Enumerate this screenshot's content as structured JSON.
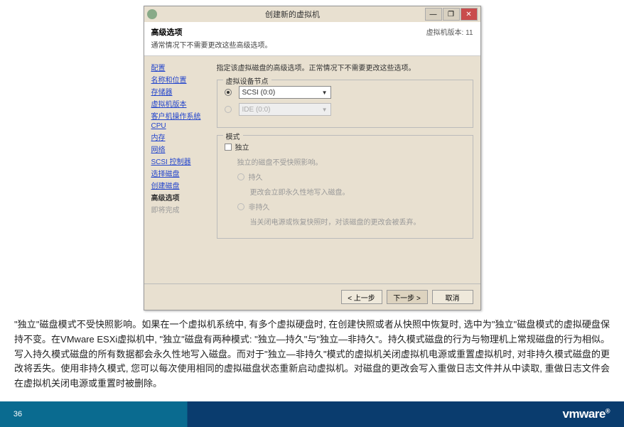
{
  "dialog": {
    "title": "创建新的虚拟机",
    "version_label": "虚拟机版本: 11",
    "header_title": "高级选项",
    "header_sub": "通常情况下不需要更改这些高级选项。",
    "close_symbol": "✕",
    "minimize_symbol": "—",
    "maximize_symbol": "❐"
  },
  "sidebar": {
    "items": [
      {
        "label": "配置"
      },
      {
        "label": "名称和位置"
      },
      {
        "label": "存储器"
      },
      {
        "label": "虚拟机版本"
      },
      {
        "label": "客户机操作系统"
      },
      {
        "label": "CPU"
      },
      {
        "label": "内存"
      },
      {
        "label": "网络"
      },
      {
        "label": "SCSI 控制器"
      },
      {
        "label": "选择磁盘"
      },
      {
        "label": "创建磁盘"
      },
      {
        "label": "高级选项",
        "active": true
      },
      {
        "label": "即将完成",
        "faded": true
      }
    ]
  },
  "content": {
    "intro": "指定该虚拟磁盘的高级选项。正常情况下不需要更改这些选项。",
    "group1": {
      "title": "虚拟设备节点",
      "scsi_label": "SCSI (0:0)",
      "ide_label": "IDE (0:0)"
    },
    "group2": {
      "title": "模式",
      "chk_label": "独立",
      "desc": "独立的磁盘不受快照影响。",
      "r1_label": "持久",
      "r1_desc": "更改会立即永久性地写入磁盘。",
      "r2_label": "非持久",
      "r2_desc": "当关闭电源或恢复快照时，对该磁盘的更改会被丢弃。"
    }
  },
  "footer": {
    "back": "< 上一步",
    "next": "下一步 >",
    "cancel": "取消"
  },
  "paragraph": "\"独立\"磁盘模式不受快照影响。如果在一个虚拟机系统中, 有多个虚拟硬盘时, 在创建快照或者从快照中恢复时, 选中为\"独立\"磁盘模式的虚拟硬盘保持不变。在VMware ESXi虚拟机中, \"独立\"磁盘有两种模式: \"独立—持久\"与\"独立—非持久\"。持久模式磁盘的行为与物理机上常规磁盘的行为相似。写入持久模式磁盘的所有数据都会永久性地写入磁盘。而对于\"独立—非持久\"模式的虚拟机关闭虚拟机电源或重置虚拟机时, 对非持久模式磁盘的更改将丢失。使用非持久模式, 您可以每次使用相同的虚拟磁盘状态重新启动虚拟机。对磁盘的更改会写入重做日志文件并从中读取, 重做日志文件会在虚拟机关闭电源或重置时被删除。",
  "page_number": "36",
  "logo": "vmware",
  "logo_r": "®"
}
